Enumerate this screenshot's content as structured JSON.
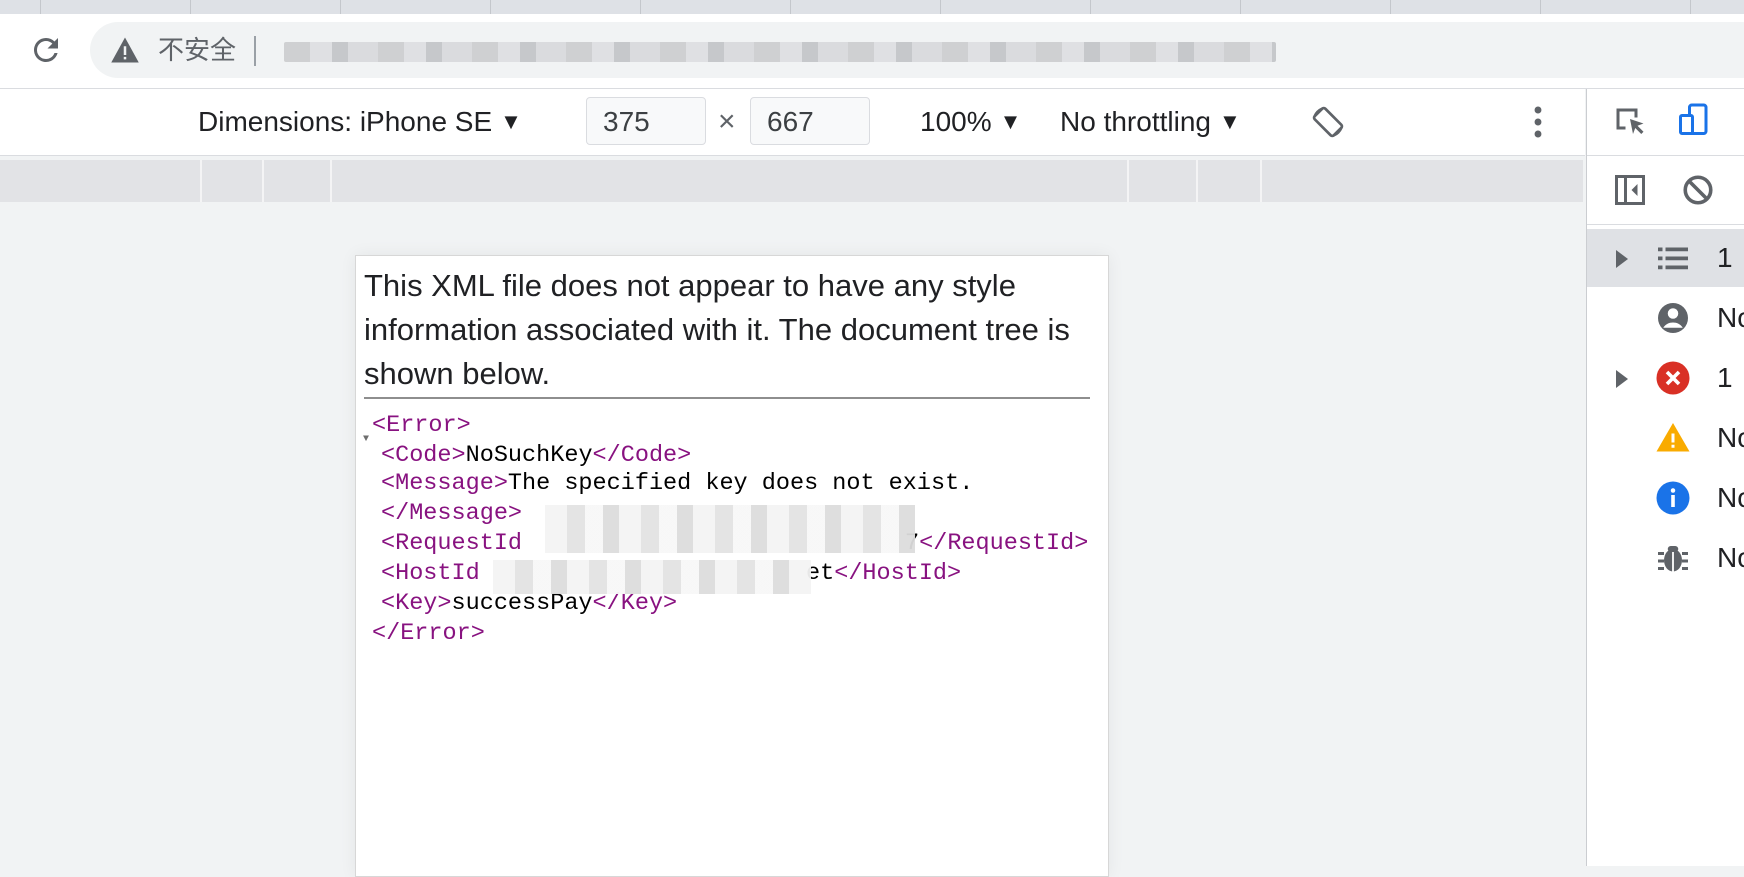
{
  "browser": {
    "security_label": "不安全"
  },
  "device_toolbar": {
    "dimensions_label": "Dimensions: iPhone SE",
    "width": "375",
    "height": "667",
    "times": "×",
    "zoom": "100%",
    "throttling": "No throttling",
    "caret": "▼"
  },
  "page": {
    "header_text": "This XML file does not appear to have any style information associated with it. The document tree is shown below.",
    "xml": {
      "error_open": "<Error>",
      "code_open": "<Code>",
      "code_value": "NoSuchKey",
      "code_close": "</Code>",
      "message_open": "<Message>",
      "message_value": "The specified key does not exist.",
      "message_close": "</Message>",
      "requestid_open": "<RequestId",
      "requestid_tail": "7",
      "requestid_close": "</RequestId>",
      "hostid_open": "<HostId",
      "hostid_tail": "et",
      "hostid_close": "</HostId>",
      "key_open": "<Key>",
      "key_value": "successPay",
      "key_close": "</Key>",
      "error_close": "</Error>"
    }
  },
  "devtools": {
    "rows": [
      {
        "label": "1",
        "icon": "list-icon"
      },
      {
        "label": "No",
        "icon": "user-icon"
      },
      {
        "label": "1",
        "icon": "error-icon"
      },
      {
        "label": "No",
        "icon": "warning-icon"
      },
      {
        "label": "No",
        "icon": "info-icon"
      },
      {
        "label": "No",
        "icon": "bug-icon"
      }
    ],
    "colors": {
      "error": "#d93025",
      "warning": "#f9ab00",
      "info": "#1a73e8",
      "accent": "#1a73e8"
    }
  }
}
